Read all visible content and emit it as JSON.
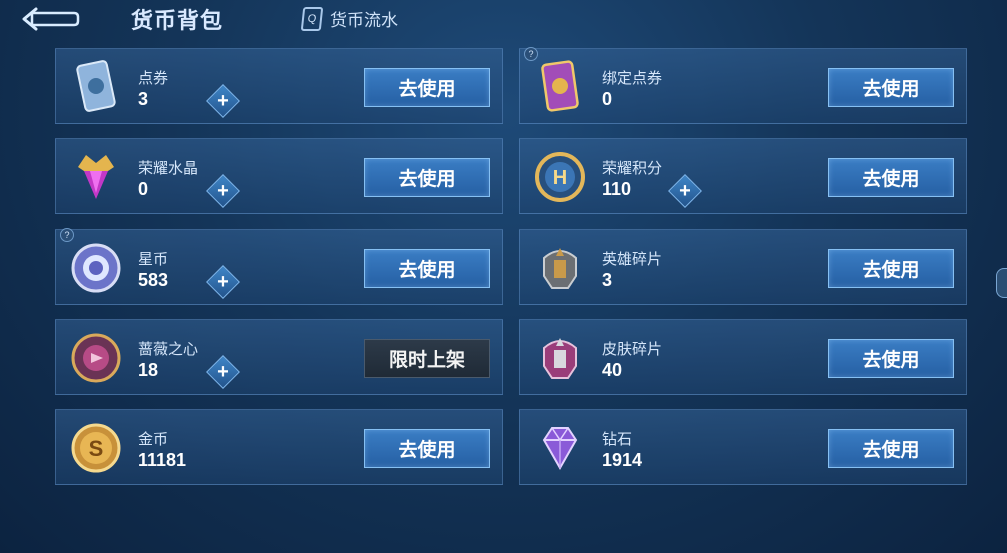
{
  "header": {
    "title": "货币背包",
    "flow_link_label": "货币流水",
    "flow_icon_glyph": "Q"
  },
  "currencies": [
    {
      "name": "点券",
      "amount": "3",
      "icon": "coupon-icon",
      "action": "去使用",
      "plus": true,
      "help": false
    },
    {
      "name": "绑定点券",
      "amount": "0",
      "icon": "bound-coupon-icon",
      "action": "去使用",
      "plus": false,
      "help": true
    },
    {
      "name": "荣耀水晶",
      "amount": "0",
      "icon": "glory-crystal-icon",
      "action": "去使用",
      "plus": true,
      "help": false
    },
    {
      "name": "荣耀积分",
      "amount": "110",
      "icon": "glory-points-icon",
      "action": "去使用",
      "plus": true,
      "help": false
    },
    {
      "name": "星币",
      "amount": "583",
      "icon": "star-coin-icon",
      "action": "去使用",
      "plus": true,
      "help": true
    },
    {
      "name": "英雄碎片",
      "amount": "3",
      "icon": "hero-fragment-icon",
      "action": "去使用",
      "plus": false,
      "help": false
    },
    {
      "name": "蔷薇之心",
      "amount": "18",
      "icon": "rose-heart-icon",
      "action": "限时上架",
      "plus": true,
      "help": false
    },
    {
      "name": "皮肤碎片",
      "amount": "40",
      "icon": "skin-fragment-icon",
      "action": "去使用",
      "plus": false,
      "help": false
    },
    {
      "name": "金币",
      "amount": "11181",
      "icon": "gold-coin-icon",
      "action": "去使用",
      "plus": false,
      "help": false
    },
    {
      "name": "钻石",
      "amount": "1914",
      "icon": "diamond-icon",
      "action": "去使用",
      "plus": false,
      "help": false
    }
  ],
  "help_glyph": "?",
  "plus_glyph": "+",
  "glory_points_glyph": "H",
  "gold_coin_glyph": "S",
  "colors": {
    "button_blue": "#2f6fb6",
    "button_dark": "#26323f",
    "card_bg": "#2a5588"
  }
}
